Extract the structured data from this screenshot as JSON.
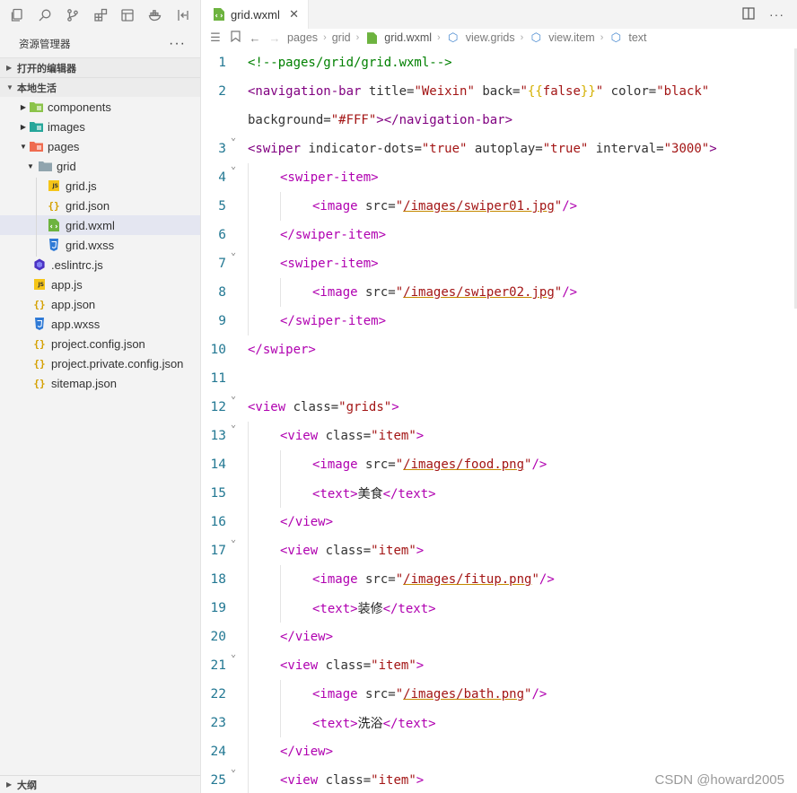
{
  "activity_bar": {
    "icons": [
      "explorer-icon",
      "search-icon",
      "source-control-icon",
      "extensions-icon",
      "layout-icon",
      "docker-icon",
      "collapse-icon"
    ]
  },
  "explorer": {
    "title": "资源管理器",
    "more": "···",
    "open_editors": "打开的编辑器",
    "workspace": "本地生活",
    "outline": "大纲",
    "tree": [
      {
        "label": "components",
        "type": "folder",
        "color": "#8bc34a"
      },
      {
        "label": "images",
        "type": "folder",
        "color": "#26a69a"
      },
      {
        "label": "pages",
        "type": "folder",
        "color": "#ef6c50"
      },
      {
        "label": "grid",
        "type": "folder",
        "color": "#90a4ae"
      },
      {
        "label": "grid.js",
        "type": "js"
      },
      {
        "label": "grid.json",
        "type": "json"
      },
      {
        "label": "grid.wxml",
        "type": "wxml"
      },
      {
        "label": "grid.wxss",
        "type": "wxss"
      },
      {
        "label": ".eslintrc.js",
        "type": "eslint"
      },
      {
        "label": "app.js",
        "type": "js"
      },
      {
        "label": "app.json",
        "type": "json"
      },
      {
        "label": "app.wxss",
        "type": "wxss"
      },
      {
        "label": "project.config.json",
        "type": "json"
      },
      {
        "label": "project.private.config.json",
        "type": "json"
      },
      {
        "label": "sitemap.json",
        "type": "json"
      }
    ]
  },
  "tab": {
    "label": "grid.wxml",
    "close": "✕"
  },
  "breadcrumbs": [
    "pages",
    "grid",
    "grid.wxml",
    "view.grids",
    "view.item",
    "text"
  ],
  "code": {
    "lines": [
      {
        "n": "1",
        "fold": false,
        "indent": 0,
        "tokens": [
          [
            "cm",
            "<!--pages/grid/grid.wxml-->"
          ]
        ]
      },
      {
        "n": "2",
        "fold": false,
        "indent": 0,
        "tokens": [
          [
            "tag",
            "<navigation-bar"
          ],
          [
            "attr",
            " title="
          ],
          [
            "str",
            "\"Weixin\""
          ],
          [
            "attr",
            " back="
          ],
          [
            "str",
            "\""
          ],
          [
            "brace",
            "{{"
          ],
          [
            "str",
            "false"
          ],
          [
            "brace",
            "}}"
          ],
          [
            "str",
            "\""
          ],
          [
            "attr",
            " color="
          ],
          [
            "str",
            "\"black\""
          ]
        ]
      },
      {
        "n": "",
        "fold": false,
        "indent": 0,
        "tokens": [
          [
            "attr",
            "background="
          ],
          [
            "str",
            "\"#FFF\""
          ],
          [
            "tag",
            "></navigation-bar>"
          ]
        ]
      },
      {
        "n": "3",
        "fold": true,
        "indent": 0,
        "tokens": [
          [
            "tag",
            "<swiper"
          ],
          [
            "attr",
            " indicator-dots="
          ],
          [
            "str",
            "\"true\""
          ],
          [
            "attr",
            " autoplay="
          ],
          [
            "str",
            "\"true\""
          ],
          [
            "attr",
            " interval="
          ],
          [
            "str",
            "\"3000\""
          ],
          [
            "tag",
            ">"
          ]
        ]
      },
      {
        "n": "4",
        "fold": true,
        "indent": 1,
        "tokens": [
          [
            "tag2",
            "<swiper-item>"
          ]
        ]
      },
      {
        "n": "5",
        "fold": false,
        "indent": 2,
        "tokens": [
          [
            "tag2",
            "<image"
          ],
          [
            "attr",
            " src="
          ],
          [
            "str",
            "\""
          ],
          [
            "link",
            "/images/swiper01.jpg"
          ],
          [
            "str",
            "\""
          ],
          [
            "tag2",
            "/>"
          ]
        ]
      },
      {
        "n": "6",
        "fold": false,
        "indent": 1,
        "tokens": [
          [
            "tag2",
            "</swiper-item>"
          ]
        ]
      },
      {
        "n": "7",
        "fold": true,
        "indent": 1,
        "tokens": [
          [
            "tag2",
            "<swiper-item>"
          ]
        ]
      },
      {
        "n": "8",
        "fold": false,
        "indent": 2,
        "tokens": [
          [
            "tag2",
            "<image"
          ],
          [
            "attr",
            " src="
          ],
          [
            "str",
            "\""
          ],
          [
            "link",
            "/images/swiper02.jpg"
          ],
          [
            "str",
            "\""
          ],
          [
            "tag2",
            "/>"
          ]
        ]
      },
      {
        "n": "9",
        "fold": false,
        "indent": 1,
        "tokens": [
          [
            "tag2",
            "</swiper-item>"
          ]
        ]
      },
      {
        "n": "10",
        "fold": false,
        "indent": 0,
        "tokens": [
          [
            "tag2",
            "</swiper>"
          ]
        ]
      },
      {
        "n": "11",
        "fold": false,
        "indent": 0,
        "tokens": []
      },
      {
        "n": "12",
        "fold": true,
        "indent": 0,
        "tokens": [
          [
            "tag2",
            "<view"
          ],
          [
            "attr",
            " class="
          ],
          [
            "str",
            "\"grids\""
          ],
          [
            "tag2",
            ">"
          ]
        ]
      },
      {
        "n": "13",
        "fold": true,
        "indent": 1,
        "tokens": [
          [
            "tag2",
            "<view"
          ],
          [
            "attr",
            " class="
          ],
          [
            "str",
            "\"item\""
          ],
          [
            "tag2",
            ">"
          ]
        ]
      },
      {
        "n": "14",
        "fold": false,
        "indent": 2,
        "tokens": [
          [
            "tag2",
            "<image"
          ],
          [
            "attr",
            " src="
          ],
          [
            "str",
            "\""
          ],
          [
            "link",
            "/images/food.png"
          ],
          [
            "str",
            "\""
          ],
          [
            "tag2",
            "/>"
          ]
        ]
      },
      {
        "n": "15",
        "fold": false,
        "indent": 2,
        "tokens": [
          [
            "tag2",
            "<text>"
          ],
          [
            "plain",
            "美食"
          ],
          [
            "tag2",
            "</text>"
          ]
        ]
      },
      {
        "n": "16",
        "fold": false,
        "indent": 1,
        "tokens": [
          [
            "tag2",
            "</view>"
          ]
        ]
      },
      {
        "n": "17",
        "fold": true,
        "indent": 1,
        "tokens": [
          [
            "tag2",
            "<view"
          ],
          [
            "attr",
            " class="
          ],
          [
            "str",
            "\"item\""
          ],
          [
            "tag2",
            ">"
          ]
        ]
      },
      {
        "n": "18",
        "fold": false,
        "indent": 2,
        "tokens": [
          [
            "tag2",
            "<image"
          ],
          [
            "attr",
            " src="
          ],
          [
            "str",
            "\""
          ],
          [
            "link",
            "/images/fitup.png"
          ],
          [
            "str",
            "\""
          ],
          [
            "tag2",
            "/>"
          ]
        ]
      },
      {
        "n": "19",
        "fold": false,
        "indent": 2,
        "tokens": [
          [
            "tag2",
            "<text>"
          ],
          [
            "plain",
            "装修"
          ],
          [
            "tag2",
            "</text>"
          ]
        ]
      },
      {
        "n": "20",
        "fold": false,
        "indent": 1,
        "tokens": [
          [
            "tag2",
            "</view>"
          ]
        ]
      },
      {
        "n": "21",
        "fold": true,
        "indent": 1,
        "tokens": [
          [
            "tag2",
            "<view"
          ],
          [
            "attr",
            " class="
          ],
          [
            "str",
            "\"item\""
          ],
          [
            "tag2",
            ">"
          ]
        ]
      },
      {
        "n": "22",
        "fold": false,
        "indent": 2,
        "tokens": [
          [
            "tag2",
            "<image"
          ],
          [
            "attr",
            " src="
          ],
          [
            "str",
            "\""
          ],
          [
            "link",
            "/images/bath.png"
          ],
          [
            "str",
            "\""
          ],
          [
            "tag2",
            "/>"
          ]
        ]
      },
      {
        "n": "23",
        "fold": false,
        "indent": 2,
        "tokens": [
          [
            "tag2",
            "<text>"
          ],
          [
            "plain",
            "洗浴"
          ],
          [
            "tag2",
            "</text>"
          ]
        ]
      },
      {
        "n": "24",
        "fold": false,
        "indent": 1,
        "tokens": [
          [
            "tag2",
            "</view>"
          ]
        ]
      },
      {
        "n": "25",
        "fold": true,
        "indent": 1,
        "tokens": [
          [
            "tag2",
            "<view"
          ],
          [
            "attr",
            " class="
          ],
          [
            "str",
            "\"item\""
          ],
          [
            "tag2",
            ">"
          ]
        ]
      }
    ]
  },
  "watermark": "CSDN @howard2005"
}
